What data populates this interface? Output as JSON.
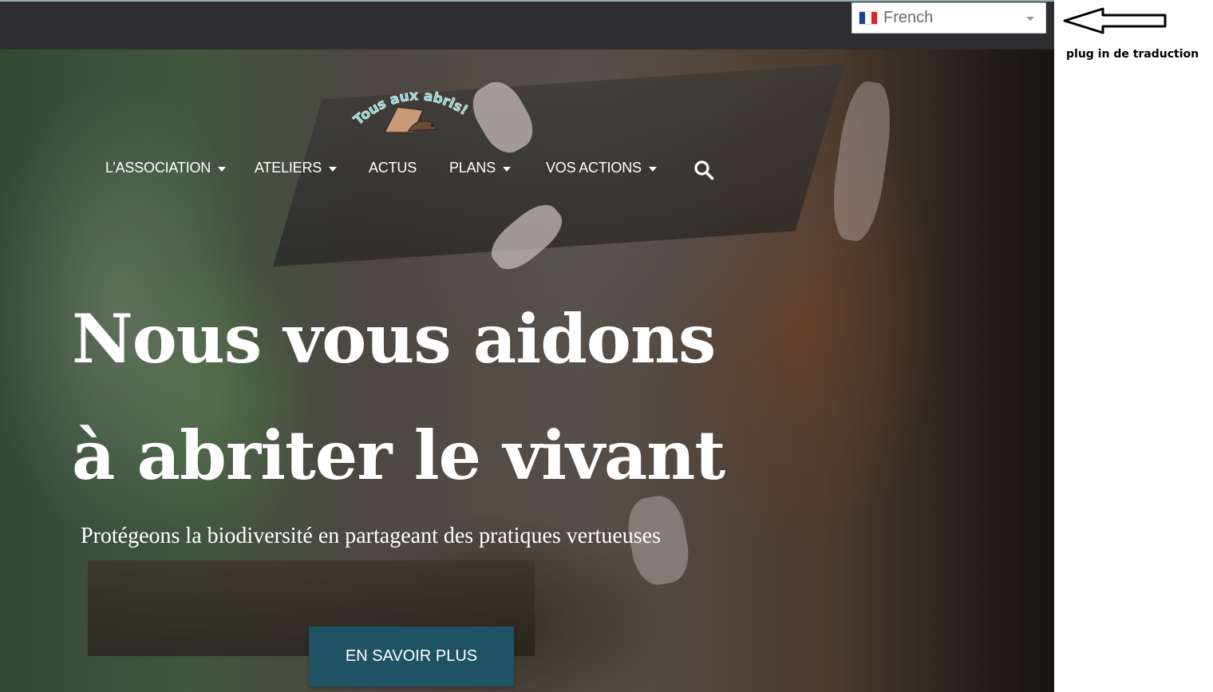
{
  "language_selector": {
    "selected": "French",
    "flag_icon": "france-flag-icon",
    "flag_colors": [
      "#1f3f99",
      "#ffffff",
      "#e3242b"
    ]
  },
  "brand": {
    "logo_text": "Tous aux abris!",
    "logo_text_color": "#7fd3d0"
  },
  "nav": {
    "items": [
      {
        "label": "L’ASSOCIATION",
        "has_dropdown": true
      },
      {
        "label": "ATELIERS",
        "has_dropdown": true
      },
      {
        "label": "ACTUS",
        "has_dropdown": false
      },
      {
        "label": "PLANS",
        "has_dropdown": true
      },
      {
        "label": "VOS ACTIONS",
        "has_dropdown": true
      }
    ],
    "search_icon": "search-icon"
  },
  "hero": {
    "headline_line1": "Nous vous aidons",
    "headline_line2": "à abriter le vivant",
    "subtitle": "Protégeons la biodiversité en partageant des pratiques vertueuses",
    "cta_label": "EN SAVOIR PLUS",
    "cta_color": "#1f5363"
  },
  "annotation": {
    "text": "plug in de traduction",
    "arrow_icon": "left-arrow-icon"
  }
}
